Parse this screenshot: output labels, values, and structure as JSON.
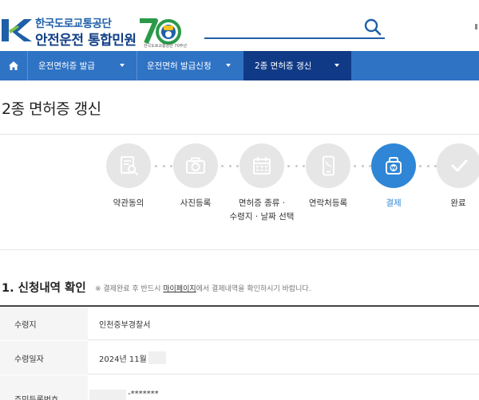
{
  "header": {
    "org_name": "한국도로교통공단",
    "site_name": "안전운전 통합민원",
    "anniversary_sub": "한국도로교통공단 70주년",
    "search_placeholder": ""
  },
  "nav": {
    "items": [
      {
        "label": "운전면허증 발급"
      },
      {
        "label": "운전면허 발급신청"
      },
      {
        "label": "2종 면허증 갱신"
      }
    ]
  },
  "page": {
    "title": "2종 면허증 갱신"
  },
  "steps": [
    {
      "label": "약관동의",
      "icon": "document-search-icon"
    },
    {
      "label": "사진등록",
      "icon": "camera-icon"
    },
    {
      "label_line1": "면허증 종류 ·",
      "label_line2": "수령지 · 날짜 선택",
      "icon": "calendar-icon"
    },
    {
      "label": "연락처등록",
      "icon": "phone-icon"
    },
    {
      "label": "결제",
      "icon": "won-wallet-icon"
    },
    {
      "label": "완료",
      "icon": "check-icon"
    }
  ],
  "section": {
    "title": "1. 신청내역 확인",
    "note_prefix": "※ 결제완료 후 반드시 ",
    "note_link": "마이페이지",
    "note_suffix": "에서 결제내역을 확인하시기 바랍니다."
  },
  "table": {
    "rows": [
      {
        "label": "수령지",
        "value": "인천중부경찰서"
      },
      {
        "label": "수령일자",
        "value": "2024년 11월"
      },
      {
        "label": "주민등록번호",
        "value": "-*******"
      }
    ]
  },
  "colors": {
    "brand_blue": "#2f73c4",
    "nav_active": "#113a86",
    "step_active": "#2f86d6"
  }
}
